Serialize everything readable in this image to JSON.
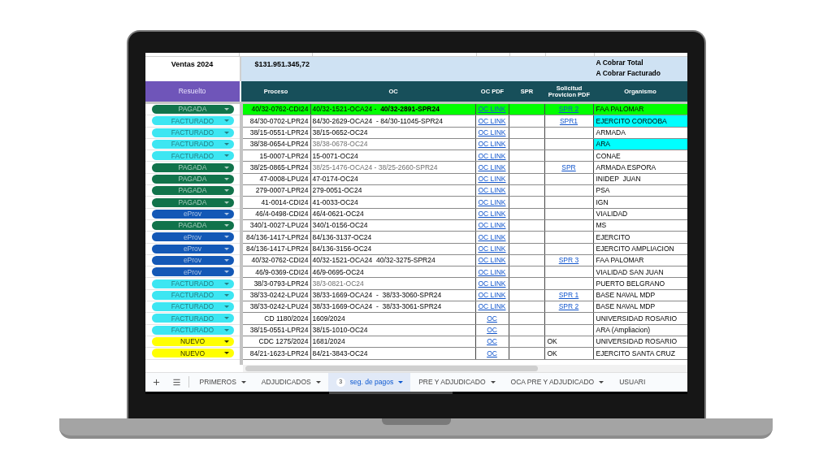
{
  "summary": {
    "title": "Ventas 2024",
    "total": "$131.951.345,72",
    "notes": [
      "A Cobrar Total",
      "A Cobrar Facturado"
    ]
  },
  "table": {
    "status_header": "Resuelto",
    "columns": [
      "Proceso",
      "OC",
      "OC PDF",
      "SPR",
      "Solicitud Provicion PDF",
      "Organismo"
    ],
    "rows": [
      {
        "status": {
          "label": "PAGADA",
          "color": "#11734b"
        },
        "color": "#00ff00",
        "proceso": "40/32-0762-CDI24",
        "oc": "40/32-1521-OCA24 -  **40/32-2891-SPR24**",
        "oc_dim": false,
        "oc_pdf": "OC LINK",
        "solicitud": {
          "kind": "link",
          "text": "SPR 2"
        },
        "organismo": {
          "text": "FAA PALOMAR"
        }
      },
      {
        "status": {
          "label": "FACTURADO",
          "color": "#3de6f2"
        },
        "proceso": "84/30-0702-LPR24",
        "oc": "84/30-2629-OCA24  - 84/30-11045-SPR24",
        "oc_dim": false,
        "oc_pdf": "OC LINK",
        "solicitud": {
          "kind": "link",
          "text": "SPR1"
        },
        "organismo": {
          "text": "EJERCITO CORDOBA",
          "color": "#00ffff"
        }
      },
      {
        "status": {
          "label": "FACTURADO",
          "color": "#3de6f2"
        },
        "proceso": "38/15-0551-LPR24",
        "oc": "38/15-0652-OC24",
        "oc_dim": false,
        "oc_pdf": "OC LINK",
        "organismo": {
          "text": "ARMADA"
        }
      },
      {
        "status": {
          "label": "FACTURADO",
          "color": "#3de6f2"
        },
        "proceso": "38/38-0654-LPR24",
        "oc": "38/38-0678-OC24",
        "oc_dim": true,
        "oc_pdf": "OC LINK",
        "organismo": {
          "text": "ARA",
          "color": "#00ffff"
        }
      },
      {
        "status": {
          "label": "FACTURADO",
          "color": "#3de6f2"
        },
        "proceso": "15-0007-LPR24",
        "oc": "15-0071-OC24",
        "oc_dim": false,
        "oc_pdf": "OC LINK",
        "organismo": {
          "text": "CONAE"
        }
      },
      {
        "status": {
          "label": "PAGADA",
          "color": "#11734b"
        },
        "proceso": "38/25-0865-LPR24",
        "oc": "38/25-1476-OCA24 - 38/25-2660-SPR24",
        "oc_dim": true,
        "oc_pdf": "OC LINK",
        "solicitud": {
          "kind": "link",
          "text": "SPR"
        },
        "organismo": {
          "text": "ARMADA ESPORA"
        }
      },
      {
        "status": {
          "label": "PAGADA",
          "color": "#11734b"
        },
        "proceso": "47-0008-LPU24",
        "oc": "47-0174-OC24",
        "oc_dim": false,
        "oc_pdf": "OC LINK",
        "organismo": {
          "text": "INIDEP  JUAN"
        }
      },
      {
        "status": {
          "label": "PAGADA",
          "color": "#11734b"
        },
        "proceso": "279-0007-LPR24",
        "oc": "279-0051-OC24",
        "oc_dim": false,
        "oc_pdf": "OC LINK",
        "organismo": {
          "text": "PSA"
        }
      },
      {
        "status": {
          "label": "PAGADA",
          "color": "#11734b"
        },
        "proceso": "41-0014-CDI24",
        "oc": "41-0033-OC24",
        "oc_dim": false,
        "oc_pdf": "OC LINK",
        "organismo": {
          "text": "IGN"
        }
      },
      {
        "status": {
          "label": "eProv",
          "color": "#1358b6"
        },
        "proceso": "46/4-0498-CDI24",
        "oc": "46/4-0621-OC24",
        "oc_dim": false,
        "oc_pdf": "OC LINK",
        "organismo": {
          "text": "VIALIDAD"
        }
      },
      {
        "status": {
          "label": "PAGADA",
          "color": "#11734b"
        },
        "proceso": "340/1-0027-LPU24",
        "oc": "340/1-0156-OC24",
        "oc_dim": false,
        "oc_pdf": "OC LINK",
        "organismo": {
          "text": "MS"
        }
      },
      {
        "status": {
          "label": "eProv",
          "color": "#1358b6"
        },
        "proceso": "84/136-1417-LPR24",
        "oc": "84/136-3137-OC24",
        "oc_dim": false,
        "oc_pdf": "OC LINK",
        "organismo": {
          "text": "EJERCITO"
        }
      },
      {
        "status": {
          "label": "eProv",
          "color": "#1358b6"
        },
        "proceso": "84/136-1417-LPR24",
        "oc": "84/136-3156-OC24",
        "oc_dim": false,
        "oc_pdf": "OC LINK",
        "organismo": {
          "text": "EJERCITO AMPLIACION"
        }
      },
      {
        "status": {
          "label": "eProv",
          "color": "#1358b6"
        },
        "proceso": "40/32-0762-CDI24",
        "oc": "40/32-1521-OCA24  40/32-3275-SPR24",
        "oc_dim": false,
        "oc_pdf": "OC LINK",
        "solicitud": {
          "kind": "link",
          "text": "SPR 3"
        },
        "organismo": {
          "text": "FAA PALOMAR"
        }
      },
      {
        "status": {
          "label": "eProv",
          "color": "#1358b6"
        },
        "proceso": "46/9-0369-CDI24",
        "oc": "46/9-0695-OC24",
        "oc_dim": false,
        "oc_pdf": "OC LINK",
        "organismo": {
          "text": "VIALIDAD SAN JUAN"
        }
      },
      {
        "status": {
          "label": "FACTURADO",
          "color": "#3de6f2"
        },
        "proceso": "38/3-0793-LPR24",
        "oc": "38/3-0821-OC24",
        "oc_dim": true,
        "oc_pdf": "OC LINK",
        "organismo": {
          "text": "PUERTO BELGRANO"
        }
      },
      {
        "status": {
          "label": "FACTURADO",
          "color": "#3de6f2"
        },
        "proceso": "38/33-0242-LPU24",
        "oc": "38/33-1669-OCA24  -  38/33-3060-SPR24",
        "oc_dim": false,
        "oc_pdf": "OC LINK",
        "solicitud": {
          "kind": "link",
          "text": "SPR 1"
        },
        "organismo": {
          "text": "BASE NAVAL MDP"
        }
      },
      {
        "status": {
          "label": "FACTURADO",
          "color": "#3de6f2"
        },
        "proceso": "38/33-0242-LPU24",
        "oc": "38/33-1669-OCA24  -  38/33-3061-SPR24",
        "oc_dim": false,
        "oc_pdf": "OC LINK",
        "solicitud": {
          "kind": "link",
          "text": "SPR 2"
        },
        "organismo": {
          "text": "BASE NAVAL MDP"
        }
      },
      {
        "status": {
          "label": "FACTURADO",
          "color": "#3de6f2"
        },
        "proceso": "CD 1180/2024",
        "oc": "1609/2024",
        "oc_dim": false,
        "oc_pdf": "OC",
        "organismo": {
          "text": "UNIVERSIDAD ROSARIO"
        }
      },
      {
        "status": {
          "label": "FACTURADO",
          "color": "#3de6f2"
        },
        "proceso": "38/15-0551-LPR24",
        "oc": "38/15-1010-OC24",
        "oc_dim": false,
        "oc_pdf": "OC",
        "organismo": {
          "text": "ARA (Ampliacion)"
        }
      },
      {
        "status": {
          "label": "NUEVO",
          "color": "#ffff00"
        },
        "proceso": "CDC 1275/2024",
        "oc": "1681/2024",
        "oc_dim": false,
        "oc_pdf": "OC",
        "solicitud": {
          "kind": "text",
          "text": "OK"
        },
        "organismo": {
          "text": "UNIVERSIDAD ROSARIO"
        }
      },
      {
        "status": {
          "label": "NUEVO",
          "color": "#ffff00"
        },
        "proceso": "84/21-1623-LPR24",
        "oc": "84/21-3843-OC24",
        "oc_dim": false,
        "oc_pdf": "OC",
        "solicitud": {
          "kind": "text",
          "text": "OK"
        },
        "organismo": {
          "text": "EJERCITO SANTA CRUZ"
        }
      }
    ]
  },
  "sheet_tabs": [
    {
      "label": "PRIMEROS",
      "selected": false,
      "caret": true
    },
    {
      "label": "ADJUDICADOS",
      "selected": false,
      "caret": true
    },
    {
      "label": "seg. de pagos",
      "selected": true,
      "caret": true,
      "badge": "3"
    },
    {
      "label": "PRE Y ADJUDICADO",
      "selected": false,
      "caret": true
    },
    {
      "label": "OCA PRE Y ADJUDICADO",
      "selected": false,
      "caret": true
    },
    {
      "label": "USUARI",
      "selected": false,
      "caret": false
    }
  ]
}
